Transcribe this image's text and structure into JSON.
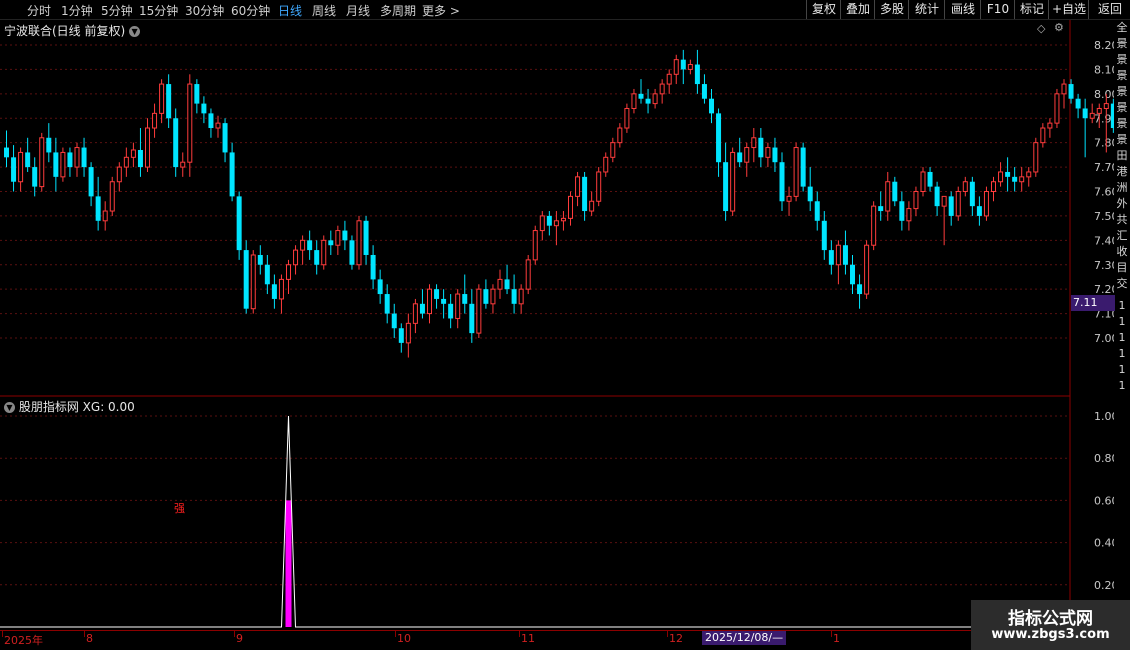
{
  "toolbar": {
    "periods": [
      {
        "label": "分时",
        "active": false
      },
      {
        "label": "1分钟",
        "active": false
      },
      {
        "label": "5分钟",
        "active": false
      },
      {
        "label": "15分钟",
        "active": false
      },
      {
        "label": "30分钟",
        "active": false
      },
      {
        "label": "60分钟",
        "active": false
      },
      {
        "label": "日线",
        "active": true
      },
      {
        "label": "周线",
        "active": false
      },
      {
        "label": "月线",
        "active": false
      },
      {
        "label": "多周期",
        "active": false
      },
      {
        "label": "更多 >",
        "active": false
      }
    ],
    "actions": [
      "复权",
      "叠加",
      "多股",
      "统计",
      "画线",
      "F10",
      "标记",
      "+自选",
      "返回"
    ]
  },
  "chart_title": "宁波联合(日线 前复权)",
  "last_price_tag": "7.11",
  "indicator": {
    "name": "股朋指标网",
    "xg_label": "XG: 0.00",
    "signal_text": "强"
  },
  "timeline": {
    "labels": [
      "2025年",
      "8",
      "9",
      "10",
      "11",
      "12",
      "1"
    ],
    "cursor_date": "2025/12/08/—"
  },
  "right_sidebar": [
    "全",
    "景",
    "景",
    "景",
    "景",
    "景",
    "景",
    "景",
    "田",
    "港",
    "洲",
    "外",
    "共",
    "汇",
    "收",
    "目",
    "交",
    "1",
    "1",
    "1",
    "1",
    "1",
    "1"
  ],
  "watermark": {
    "name": "指标公式网",
    "url": "www.zbgs3.com"
  },
  "colors": {
    "up": "#ff3c3c",
    "down": "#00e5ff",
    "grid": "#5a1010",
    "signal": "#ff00ff"
  },
  "chart_data": [
    {
      "type": "candlestick",
      "title": "宁波联合(日线 前复权)",
      "y_ticks": [
        8.2,
        8.1,
        8.0,
        7.9,
        7.8,
        7.7,
        7.6,
        7.5,
        7.4,
        7.3,
        7.2,
        7.1,
        7.0
      ],
      "ylim": [
        6.85,
        8.25
      ],
      "x_labels": [
        "2025年",
        "8",
        "9",
        "10",
        "11",
        "12",
        "1"
      ],
      "ohlc": [
        [
          7.78,
          7.85,
          7.7,
          7.74
        ],
        [
          7.74,
          7.79,
          7.6,
          7.64
        ],
        [
          7.64,
          7.78,
          7.6,
          7.76
        ],
        [
          7.76,
          7.82,
          7.68,
          7.7
        ],
        [
          7.7,
          7.74,
          7.58,
          7.62
        ],
        [
          7.62,
          7.84,
          7.6,
          7.82
        ],
        [
          7.82,
          7.88,
          7.72,
          7.76
        ],
        [
          7.76,
          7.82,
          7.6,
          7.66
        ],
        [
          7.66,
          7.78,
          7.64,
          7.76
        ],
        [
          7.76,
          7.78,
          7.66,
          7.7
        ],
        [
          7.7,
          7.8,
          7.66,
          7.78
        ],
        [
          7.78,
          7.82,
          7.66,
          7.7
        ],
        [
          7.7,
          7.72,
          7.54,
          7.58
        ],
        [
          7.58,
          7.66,
          7.44,
          7.48
        ],
        [
          7.48,
          7.56,
          7.44,
          7.52
        ],
        [
          7.52,
          7.66,
          7.5,
          7.64
        ],
        [
          7.64,
          7.72,
          7.6,
          7.7
        ],
        [
          7.7,
          7.78,
          7.66,
          7.74
        ],
        [
          7.74,
          7.8,
          7.7,
          7.77
        ],
        [
          7.77,
          7.86,
          7.66,
          7.7
        ],
        [
          7.7,
          7.9,
          7.68,
          7.86
        ],
        [
          7.86,
          7.96,
          7.82,
          7.92
        ],
        [
          7.92,
          8.06,
          7.88,
          8.04
        ],
        [
          8.04,
          8.08,
          7.86,
          7.9
        ],
        [
          7.9,
          7.94,
          7.66,
          7.7
        ],
        [
          7.7,
          7.76,
          7.66,
          7.72
        ],
        [
          7.72,
          8.08,
          7.66,
          8.04
        ],
        [
          8.04,
          8.06,
          7.92,
          7.96
        ],
        [
          7.96,
          7.99,
          7.88,
          7.92
        ],
        [
          7.92,
          7.94,
          7.82,
          7.86
        ],
        [
          7.86,
          7.91,
          7.82,
          7.88
        ],
        [
          7.88,
          7.9,
          7.72,
          7.76
        ],
        [
          7.76,
          7.8,
          7.56,
          7.58
        ],
        [
          7.58,
          7.6,
          7.32,
          7.36
        ],
        [
          7.36,
          7.4,
          7.1,
          7.12
        ],
        [
          7.12,
          7.36,
          7.1,
          7.34
        ],
        [
          7.34,
          7.38,
          7.26,
          7.3
        ],
        [
          7.3,
          7.34,
          7.18,
          7.22
        ],
        [
          7.22,
          7.26,
          7.12,
          7.16
        ],
        [
          7.16,
          7.26,
          7.1,
          7.24
        ],
        [
          7.24,
          7.32,
          7.18,
          7.3
        ],
        [
          7.3,
          7.38,
          7.26,
          7.36
        ],
        [
          7.36,
          7.42,
          7.3,
          7.4
        ],
        [
          7.4,
          7.44,
          7.32,
          7.36
        ],
        [
          7.36,
          7.4,
          7.26,
          7.3
        ],
        [
          7.3,
          7.42,
          7.28,
          7.4
        ],
        [
          7.4,
          7.44,
          7.34,
          7.38
        ],
        [
          7.38,
          7.46,
          7.34,
          7.44
        ],
        [
          7.44,
          7.48,
          7.36,
          7.4
        ],
        [
          7.4,
          7.42,
          7.28,
          7.3
        ],
        [
          7.3,
          7.5,
          7.28,
          7.48
        ],
        [
          7.48,
          7.5,
          7.3,
          7.34
        ],
        [
          7.34,
          7.38,
          7.2,
          7.24
        ],
        [
          7.24,
          7.28,
          7.14,
          7.18
        ],
        [
          7.18,
          7.22,
          7.06,
          7.1
        ],
        [
          7.1,
          7.14,
          7.0,
          7.04
        ],
        [
          7.04,
          7.06,
          6.94,
          6.98
        ],
        [
          6.98,
          7.1,
          6.92,
          7.06
        ],
        [
          7.06,
          7.16,
          7.02,
          7.14
        ],
        [
          7.14,
          7.2,
          7.08,
          7.1
        ],
        [
          7.1,
          7.22,
          7.06,
          7.2
        ],
        [
          7.2,
          7.22,
          7.12,
          7.16
        ],
        [
          7.16,
          7.2,
          7.08,
          7.14
        ],
        [
          7.14,
          7.18,
          7.04,
          7.08
        ],
        [
          7.08,
          7.2,
          7.04,
          7.18
        ],
        [
          7.18,
          7.26,
          7.1,
          7.14
        ],
        [
          7.14,
          7.2,
          6.98,
          7.02
        ],
        [
          7.02,
          7.22,
          7.0,
          7.2
        ],
        [
          7.2,
          7.24,
          7.12,
          7.14
        ],
        [
          7.14,
          7.22,
          7.1,
          7.2
        ],
        [
          7.2,
          7.28,
          7.16,
          7.24
        ],
        [
          7.24,
          7.3,
          7.18,
          7.2
        ],
        [
          7.2,
          7.26,
          7.1,
          7.14
        ],
        [
          7.14,
          7.22,
          7.1,
          7.2
        ],
        [
          7.2,
          7.34,
          7.18,
          7.32
        ],
        [
          7.32,
          7.46,
          7.3,
          7.44
        ],
        [
          7.44,
          7.52,
          7.4,
          7.5
        ],
        [
          7.5,
          7.52,
          7.42,
          7.46
        ],
        [
          7.46,
          7.52,
          7.38,
          7.48
        ],
        [
          7.48,
          7.52,
          7.44,
          7.49
        ],
        [
          7.49,
          7.6,
          7.46,
          7.58
        ],
        [
          7.58,
          7.68,
          7.54,
          7.66
        ],
        [
          7.66,
          7.68,
          7.48,
          7.52
        ],
        [
          7.52,
          7.6,
          7.5,
          7.56
        ],
        [
          7.56,
          7.7,
          7.54,
          7.68
        ],
        [
          7.68,
          7.76,
          7.66,
          7.74
        ],
        [
          7.74,
          7.82,
          7.72,
          7.8
        ],
        [
          7.8,
          7.88,
          7.78,
          7.86
        ],
        [
          7.86,
          7.96,
          7.84,
          7.94
        ],
        [
          7.94,
          8.02,
          7.92,
          8.0
        ],
        [
          8.0,
          8.06,
          7.96,
          7.98
        ],
        [
          7.98,
          8.02,
          7.92,
          7.96
        ],
        [
          7.96,
          8.02,
          7.94,
          8.0
        ],
        [
          8.0,
          8.06,
          7.96,
          8.04
        ],
        [
          8.04,
          8.1,
          8.0,
          8.08
        ],
        [
          8.08,
          8.16,
          8.04,
          8.14
        ],
        [
          8.14,
          8.18,
          8.04,
          8.1
        ],
        [
          8.1,
          8.14,
          8.08,
          8.12
        ],
        [
          8.12,
          8.18,
          8.0,
          8.04
        ],
        [
          8.04,
          8.08,
          7.96,
          7.98
        ],
        [
          7.98,
          8.02,
          7.88,
          7.92
        ],
        [
          7.92,
          7.94,
          7.66,
          7.72
        ],
        [
          7.72,
          7.8,
          7.48,
          7.52
        ],
        [
          7.52,
          7.78,
          7.5,
          7.76
        ],
        [
          7.76,
          7.82,
          7.7,
          7.72
        ],
        [
          7.72,
          7.8,
          7.66,
          7.78
        ],
        [
          7.78,
          7.86,
          7.72,
          7.82
        ],
        [
          7.82,
          7.86,
          7.7,
          7.74
        ],
        [
          7.74,
          7.8,
          7.7,
          7.78
        ],
        [
          7.78,
          7.82,
          7.68,
          7.72
        ],
        [
          7.72,
          7.76,
          7.52,
          7.56
        ],
        [
          7.56,
          7.62,
          7.5,
          7.58
        ],
        [
          7.58,
          7.8,
          7.56,
          7.78
        ],
        [
          7.78,
          7.8,
          7.6,
          7.62
        ],
        [
          7.62,
          7.7,
          7.52,
          7.56
        ],
        [
          7.56,
          7.6,
          7.44,
          7.48
        ],
        [
          7.48,
          7.52,
          7.32,
          7.36
        ],
        [
          7.36,
          7.4,
          7.26,
          7.3
        ],
        [
          7.3,
          7.4,
          7.22,
          7.38
        ],
        [
          7.38,
          7.44,
          7.26,
          7.3
        ],
        [
          7.3,
          7.34,
          7.18,
          7.22
        ],
        [
          7.22,
          7.26,
          7.12,
          7.18
        ],
        [
          7.18,
          7.4,
          7.16,
          7.38
        ],
        [
          7.38,
          7.56,
          7.36,
          7.54
        ],
        [
          7.54,
          7.6,
          7.48,
          7.52
        ],
        [
          7.52,
          7.68,
          7.48,
          7.64
        ],
        [
          7.64,
          7.66,
          7.54,
          7.56
        ],
        [
          7.56,
          7.6,
          7.44,
          7.48
        ],
        [
          7.48,
          7.56,
          7.44,
          7.53
        ],
        [
          7.53,
          7.62,
          7.5,
          7.6
        ],
        [
          7.6,
          7.7,
          7.58,
          7.68
        ],
        [
          7.68,
          7.7,
          7.6,
          7.62
        ],
        [
          7.62,
          7.64,
          7.5,
          7.54
        ],
        [
          7.54,
          7.58,
          7.38,
          7.58
        ],
        [
          7.58,
          7.6,
          7.46,
          7.5
        ],
        [
          7.5,
          7.62,
          7.48,
          7.6
        ],
        [
          7.6,
          7.66,
          7.58,
          7.64
        ],
        [
          7.64,
          7.66,
          7.5,
          7.54
        ],
        [
          7.54,
          7.58,
          7.46,
          7.5
        ],
        [
          7.5,
          7.62,
          7.48,
          7.6
        ],
        [
          7.6,
          7.66,
          7.56,
          7.64
        ],
        [
          7.64,
          7.72,
          7.62,
          7.68
        ],
        [
          7.68,
          7.74,
          7.6,
          7.66
        ],
        [
          7.66,
          7.7,
          7.6,
          7.64
        ],
        [
          7.64,
          7.7,
          7.6,
          7.66
        ],
        [
          7.66,
          7.7,
          7.62,
          7.68
        ],
        [
          7.68,
          7.82,
          7.66,
          7.8
        ],
        [
          7.8,
          7.88,
          7.78,
          7.86
        ],
        [
          7.86,
          7.9,
          7.82,
          7.88
        ],
        [
          7.88,
          8.02,
          7.86,
          8.0
        ],
        [
          8.0,
          8.06,
          7.94,
          8.04
        ],
        [
          8.04,
          8.06,
          7.96,
          7.98
        ],
        [
          7.98,
          8.0,
          7.9,
          7.94
        ],
        [
          7.94,
          7.98,
          7.74,
          7.9
        ],
        [
          7.9,
          7.96,
          7.88,
          7.92
        ],
        [
          7.92,
          7.96,
          7.86,
          7.94
        ],
        [
          7.94,
          8.0,
          7.76,
          7.96
        ],
        [
          7.96,
          7.98,
          7.84,
          7.86
        ],
        [
          7.86,
          7.94,
          7.82,
          7.92
        ],
        [
          7.92,
          7.98,
          7.88,
          7.96
        ],
        [
          7.96,
          8.04,
          7.94,
          8.02
        ],
        [
          8.02,
          8.1,
          8.0,
          8.08
        ],
        [
          8.08,
          8.14,
          8.04,
          8.12
        ],
        [
          8.12,
          8.18,
          8.08,
          8.16
        ],
        [
          8.16,
          8.22,
          8.12,
          8.18
        ],
        [
          8.18,
          8.22,
          8.14,
          8.16
        ],
        [
          8.16,
          8.18,
          8.08,
          8.1
        ],
        [
          8.1,
          8.14,
          7.96,
          7.98
        ],
        [
          7.98,
          8.04,
          7.96,
          8.0
        ]
      ]
    },
    {
      "type": "line",
      "title": "股朋指标网",
      "y_ticks": [
        1.0,
        0.8,
        0.6,
        0.4,
        0.2
      ],
      "ylim": [
        0,
        1.05
      ],
      "series": [
        {
          "name": "XG",
          "spike_index": 40,
          "spike_value": 1.0
        }
      ],
      "signal_bar": {
        "index": 40,
        "value": 0.6
      }
    }
  ]
}
